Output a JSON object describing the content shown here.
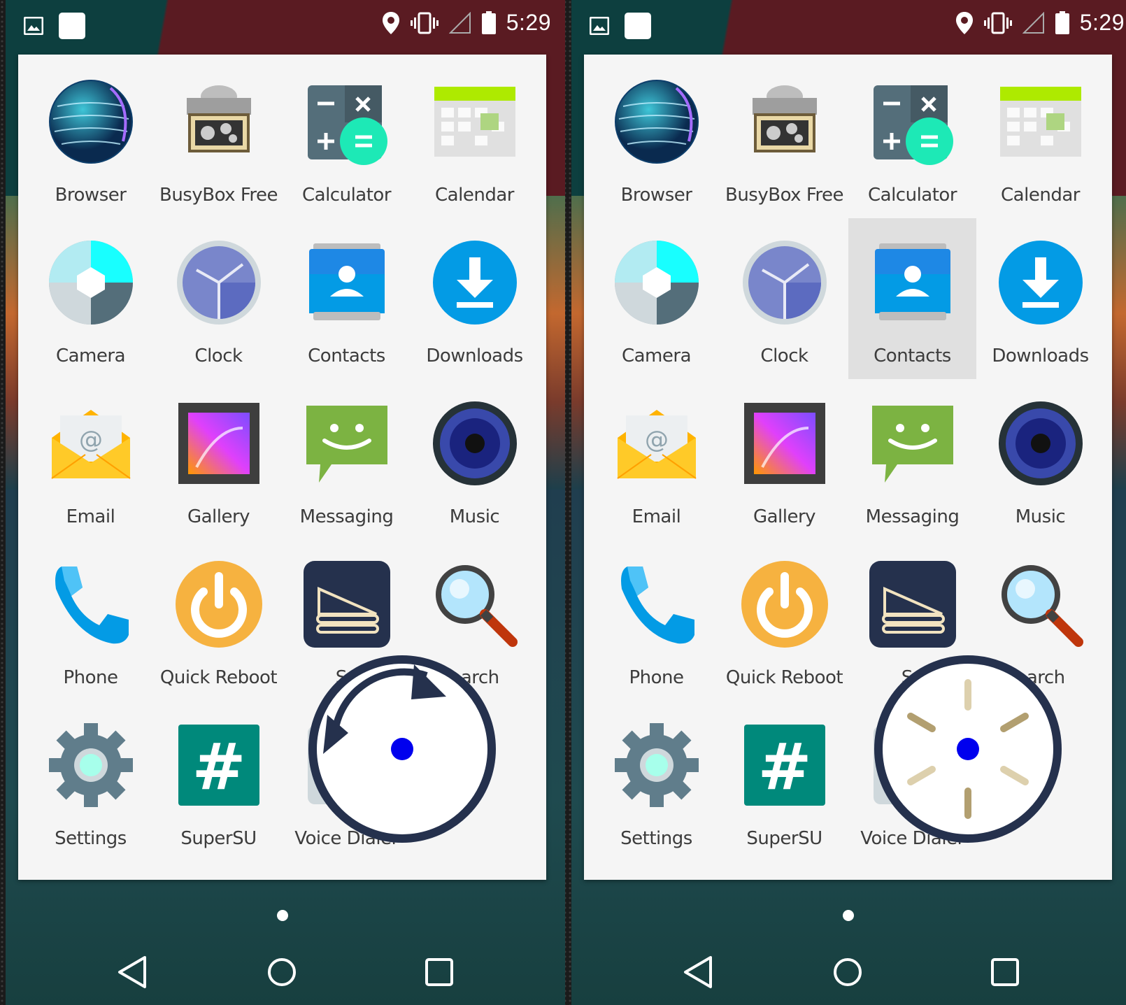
{
  "status_bar": {
    "time": "5:29",
    "left_icons": [
      "image-notification-icon",
      "blank-notification-icon"
    ],
    "right_icons": [
      "location-icon",
      "vibrate-icon",
      "signal-icon",
      "battery-icon"
    ]
  },
  "apps": [
    {
      "label": "Browser",
      "icon": "browser-icon"
    },
    {
      "label": "BusyBox Free",
      "icon": "busybox-icon"
    },
    {
      "label": "Calculator",
      "icon": "calculator-icon"
    },
    {
      "label": "Calendar",
      "icon": "calendar-icon"
    },
    {
      "label": "Camera",
      "icon": "camera-icon"
    },
    {
      "label": "Clock",
      "icon": "clock-icon"
    },
    {
      "label": "Contacts",
      "icon": "contacts-icon"
    },
    {
      "label": "Downloads",
      "icon": "downloads-icon"
    },
    {
      "label": "Email",
      "icon": "email-icon"
    },
    {
      "label": "Gallery",
      "icon": "gallery-icon"
    },
    {
      "label": "Messaging",
      "icon": "messaging-icon"
    },
    {
      "label": "Music",
      "icon": "music-icon"
    },
    {
      "label": "Phone",
      "icon": "phone-icon"
    },
    {
      "label": "Quick Reboot",
      "icon": "quick-reboot-icon"
    },
    {
      "label": "Sa",
      "icon": "sandwich-icon"
    },
    {
      "label": "earch",
      "icon": "search-icon"
    },
    {
      "label": "Settings",
      "icon": "settings-icon"
    },
    {
      "label": "SuperSU",
      "icon": "supersu-icon"
    },
    {
      "label": "Voice Dialer",
      "icon": "voice-dialer-icon"
    }
  ],
  "screens": [
    {
      "name": "left",
      "highlighted_app": null,
      "overlay": "rotate-gesture-icon"
    },
    {
      "name": "right",
      "highlighted_app": "Contacts",
      "overlay": "loading-spinner-icon"
    }
  ],
  "nav": [
    "back-button",
    "home-button",
    "recents-button"
  ],
  "colors": {
    "drawer": "#f5f5f5",
    "label": "#3c3c3c",
    "overlay_ring": "#25314d",
    "touch_dot": "#0000ee"
  }
}
